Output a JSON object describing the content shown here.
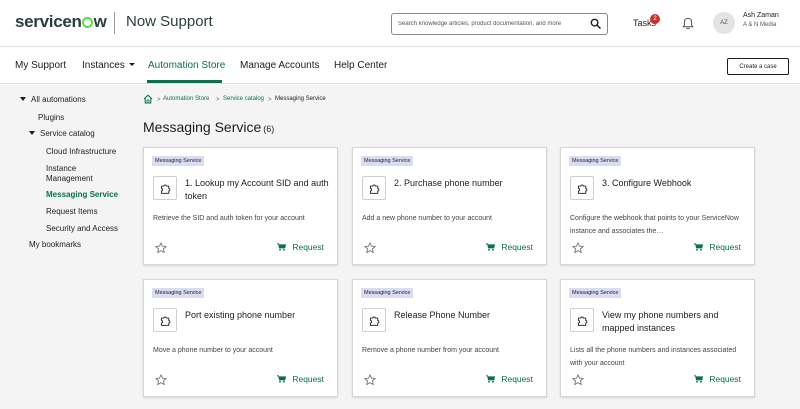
{
  "header": {
    "brand": "servicenow",
    "portal_title": "Now Support",
    "search_placeholder": "Search knowledge articles, product documentation, and more",
    "tasks_label": "Tasks",
    "tasks_count": "2",
    "user_initials": "AZ",
    "user_name": "Ash Zaman",
    "user_org": "A & N Media"
  },
  "nav": {
    "items": [
      "My Support",
      "Instances",
      "Automation Store",
      "Manage Accounts",
      "Help Center"
    ],
    "active": "Automation Store",
    "create_case_label": "Create a case"
  },
  "sidebar": {
    "all": "All automations",
    "plugins": "Plugins",
    "service_catalog": "Service catalog",
    "cloud_infra": "Cloud Infrastructure",
    "instance_mgmt_1": "Instance",
    "instance_mgmt_2": "Management",
    "messaging": "Messaging Service",
    "request_items": "Request Items",
    "security": "Security and Access",
    "bookmarks": "My bookmarks"
  },
  "breadcrumb": {
    "items": [
      "Automation Store",
      "Service catalog",
      "Messaging Service"
    ]
  },
  "page": {
    "title": "Messaging Service",
    "count": "(6)"
  },
  "cards": [
    {
      "tag": "Messaging Service",
      "title": "1. Lookup my Account SID and auth token",
      "description": "Retrieve the SID and auth token for your account",
      "action": "Request"
    },
    {
      "tag": "Messaging Service",
      "title": "2. Purchase phone number",
      "description": "Add a new phone number to your account",
      "action": "Request"
    },
    {
      "tag": "Messaging Service",
      "title": "3. Configure Webhook",
      "description": "Configure the webhook that points to your ServiceNow instance and associates the…",
      "action": "Request"
    },
    {
      "tag": "Messaging Service",
      "title": "Port existing phone number",
      "description": "Move a phone number to your account",
      "action": "Request"
    },
    {
      "tag": "Messaging Service",
      "title": "Release Phone Number",
      "description": "Remove a phone number from your account",
      "action": "Request"
    },
    {
      "tag": "Messaging Service",
      "title": "View my phone numbers and mapped instances",
      "description": "Lists all the phone numbers and instances associated with your account",
      "action": "Request"
    }
  ],
  "colors": {
    "accent": "#0b6f52",
    "brand_green": "#62d84e",
    "tag_bg": "#d9dcf3",
    "badge": "#c8342c"
  },
  "icons": {
    "search": "search-icon",
    "notifications": "bell-icon",
    "home": "home-icon",
    "card": "puzzle-icon",
    "bookmark": "star-icon",
    "request": "cart-icon"
  }
}
